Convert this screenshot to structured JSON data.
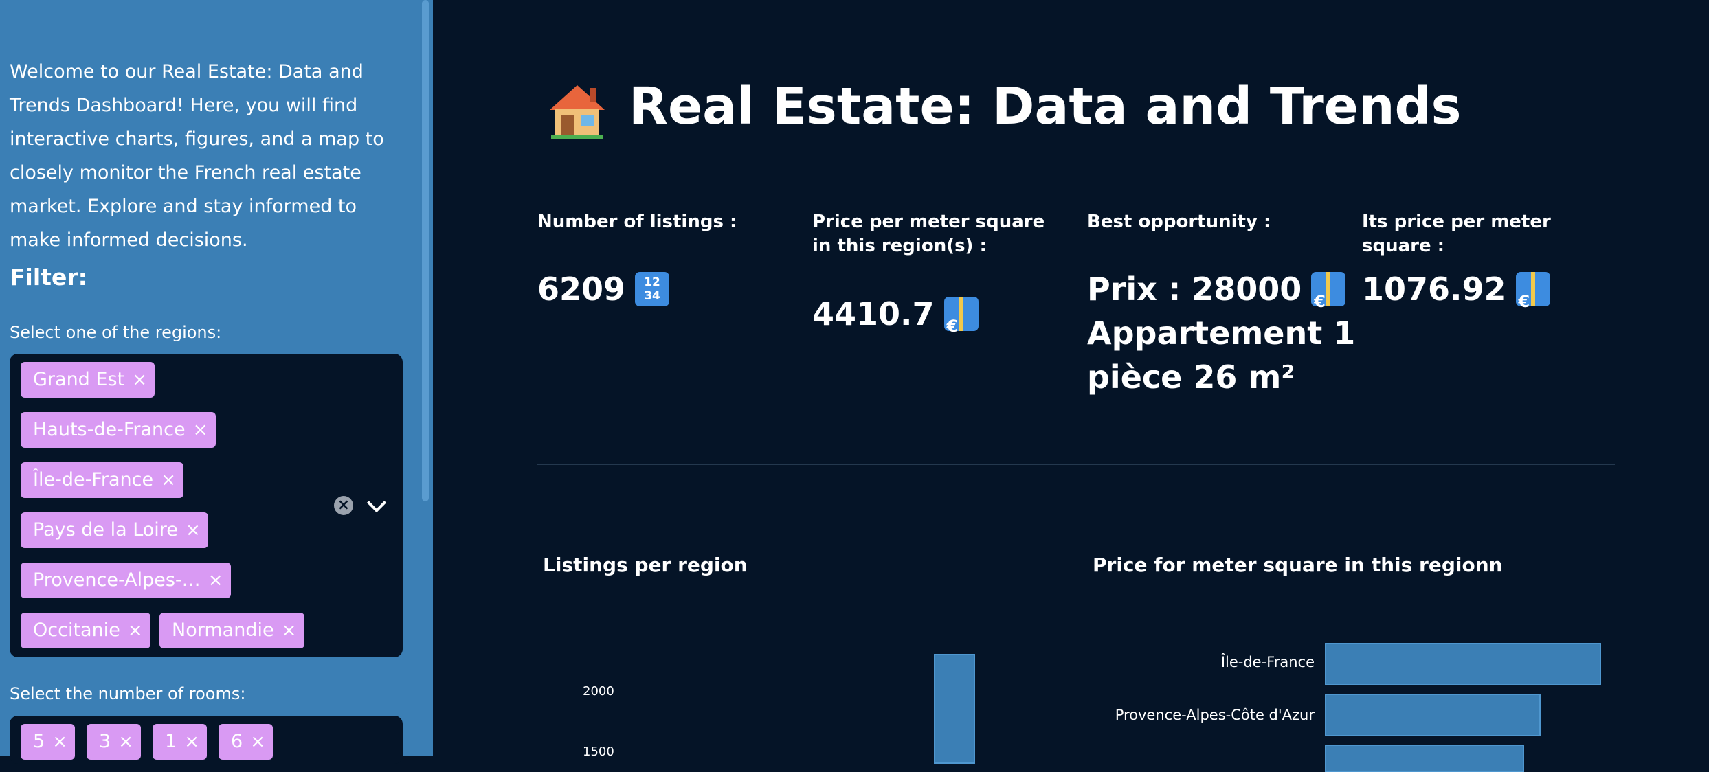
{
  "sidebar": {
    "intro": "Welcome to our Real Estate: Data and Trends Dashboard! Here, you will find interactive charts, figures, and a map to closely monitor the French real estate market. Explore and stay informed to make informed decisions.",
    "filter_title": "Filter:",
    "regions_label": "Select one of the regions:",
    "regions_selected": [
      "Grand Est",
      "Hauts-de-France",
      "Île-de-France",
      "Pays de la Loire",
      "Provence-Alpes-…",
      "Occitanie",
      "Normandie"
    ],
    "rooms_label": "Select the number of rooms:",
    "rooms_selected": [
      "5",
      "3",
      "1",
      "6"
    ],
    "remove_glyph": "×",
    "clear_glyph": "×"
  },
  "main": {
    "title": "Real Estate: Data and Trends",
    "metrics": {
      "listings_label": "Number of listings :",
      "listings_value": "6209",
      "price_label": "Price per meter square in this region(s) :",
      "price_value": "4410.7",
      "best_label": "Best opportunity :",
      "best_value_line1": "Prix : 28000",
      "best_value_line2": "Appartement 1",
      "best_value_line3": "pièce 26 m²",
      "its_price_label": "Its price per meter square :",
      "its_price_value": "1076.92",
      "numbers_badge": "1234"
    }
  },
  "colors": {
    "sidebar_bg": "#3b7fb5",
    "main_bg": "#051427",
    "tag_bg": "#d99af3",
    "bar": "#3b7fb5"
  },
  "charts": {
    "listings": {
      "title": "Listings per region",
      "ytick_2000": "2000",
      "ytick_1500": "1500"
    },
    "price": {
      "title": "Price for meter square in this regionn",
      "label_idf": "Île-de-France",
      "label_paca": "Provence-Alpes-Côte d'Azur"
    }
  },
  "chart_data": [
    {
      "type": "bar",
      "title": "Listings per region",
      "yticks": [
        1500,
        2000
      ],
      "visible_values": [
        2150
      ],
      "note_labels": []
    },
    {
      "type": "bar",
      "orientation": "horizontal",
      "title": "Price for meter square in this regionn",
      "categories": [
        "Île-de-France",
        "Provence-Alpes-Côte d'Azur"
      ],
      "values": [
        6800,
        5300
      ]
    }
  ]
}
